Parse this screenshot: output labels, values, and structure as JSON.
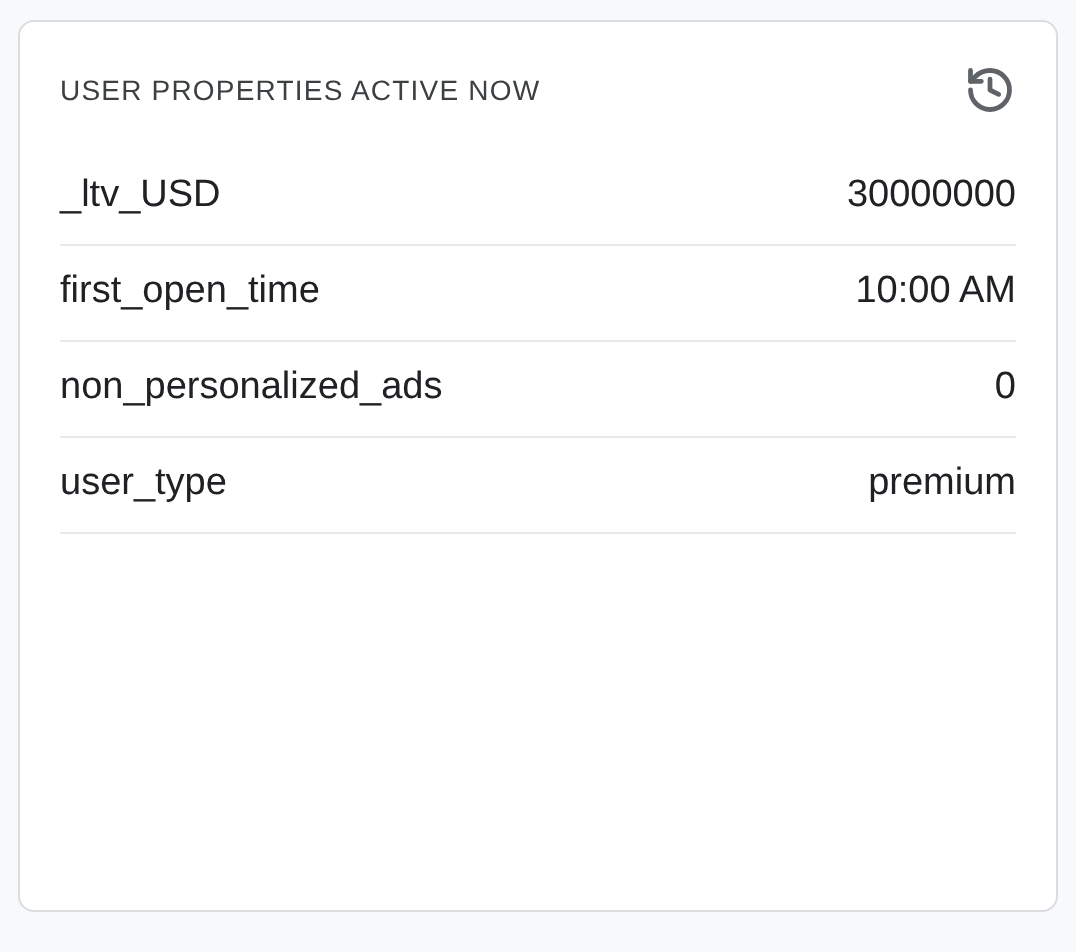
{
  "card": {
    "title": "USER PROPERTIES ACTIVE NOW"
  },
  "properties": [
    {
      "name": "_ltv_USD",
      "value": "30000000"
    },
    {
      "name": "first_open_time",
      "value": "10:00 AM"
    },
    {
      "name": "non_personalized_ads",
      "value": "0"
    },
    {
      "name": "user_type",
      "value": "premium"
    }
  ]
}
